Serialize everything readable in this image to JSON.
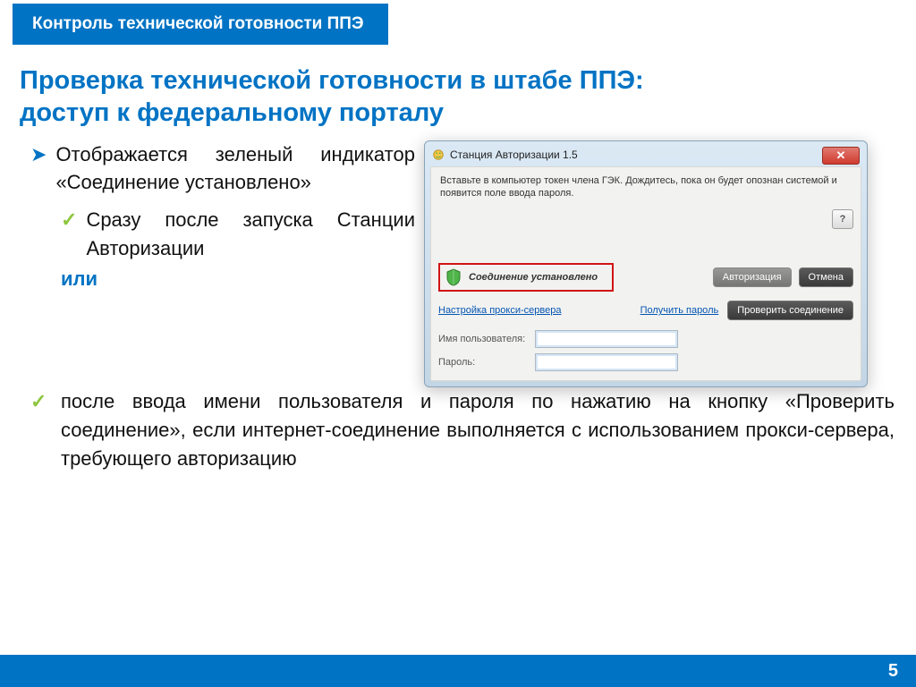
{
  "banner": "Контроль технической готовности ППЭ",
  "title_line1": "Проверка технической готовности в штабе ППЭ:",
  "title_line2": "доступ к федеральному порталу",
  "bullet_arrow": "Отображается зеленый индикатор «Соединение установлено»",
  "bullet_check1": "Сразу после запуска Станции Авторизации",
  "or_word": "или",
  "bullet_check2": "после ввода имени пользователя и пароля по нажатию на кнопку «Проверить соединение», если интернет-соединение выполняется с использованием прокси-сервера, требующего авторизацию",
  "page_number": "5",
  "win": {
    "title": "Станция Авторизации 1.5",
    "close": "✕",
    "instruction": "Вставьте в компьютер токен члена ГЭК. Дождитесь, пока он будет опознан системой и появится поле ввода пароля.",
    "help": "?",
    "status": "Соединение установлено",
    "btn_auth": "Авторизация",
    "btn_cancel": "Отмена",
    "link_proxy": "Настройка прокси-сервера",
    "link_getpwd": "Получить пароль",
    "btn_check": "Проверить соединение",
    "label_user": "Имя пользователя:",
    "label_pwd": "Пароль:"
  }
}
